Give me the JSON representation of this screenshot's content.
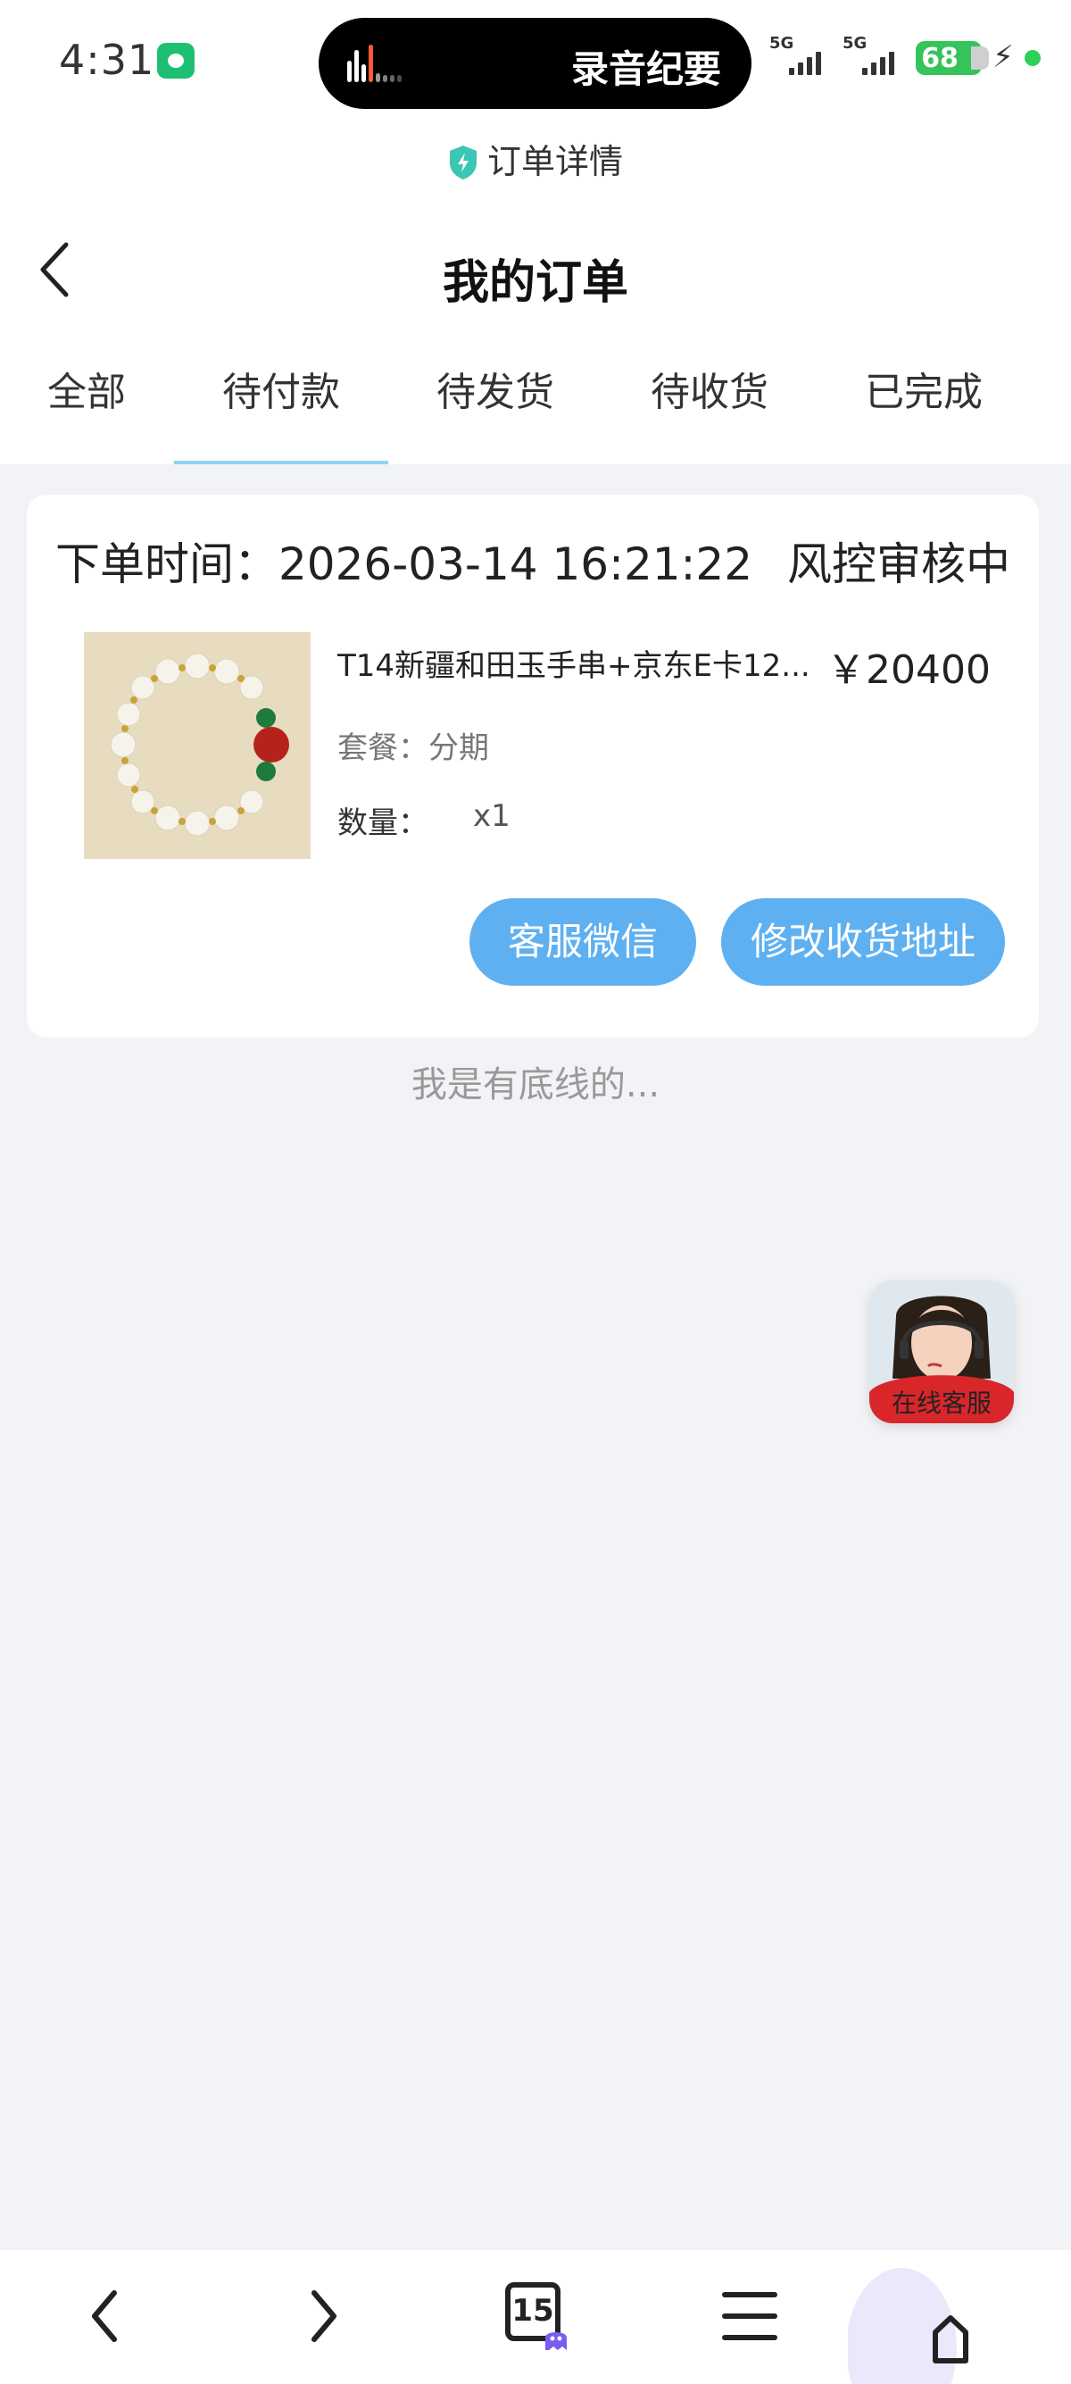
{
  "status_bar": {
    "time": "4:31",
    "island_text": "录音纪要",
    "signal_1": "5G",
    "signal_2": "5G",
    "battery": "68"
  },
  "page_label": "订单详情",
  "header": {
    "title": "我的订单"
  },
  "tabs": [
    {
      "label": "全部"
    },
    {
      "label": "待付款"
    },
    {
      "label": "待发货"
    },
    {
      "label": "待收货"
    },
    {
      "label": "已完成"
    }
  ],
  "active_tab": "待付款",
  "order": {
    "time_label": "下单时间：",
    "time_value": "2026-03-14 16:21:22",
    "status": "风控审核中",
    "product_name": "T14新疆和田玉手串+京东E卡12...",
    "price": "￥20400",
    "package_label": "套餐：",
    "package_value": "分期",
    "qty_label": "数量：",
    "qty_value": "x1",
    "btn_wechat": "客服微信",
    "btn_address": "修改收货地址"
  },
  "footer_note": "我是有底线的...",
  "cs_float_label": "在线客服",
  "bottom_bar": {
    "tab_count": "15"
  },
  "colors": {
    "accent_button": "#5fb0f0",
    "tab_indicator": "#8fd3f0",
    "battery": "#36c35a",
    "page_bg": "#f2f3f6"
  }
}
